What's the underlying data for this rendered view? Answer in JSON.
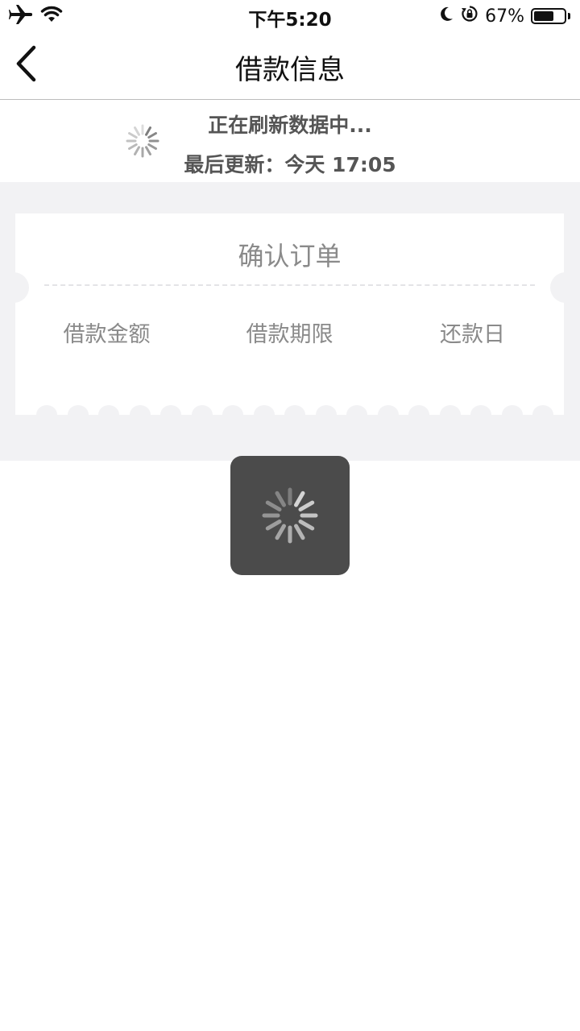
{
  "status_bar": {
    "time": "下午5:20",
    "battery_text": "67%",
    "battery_level": 0.67,
    "icons": [
      "airplane-icon",
      "wifi-icon",
      "moon-icon",
      "rotation-lock-icon",
      "battery-icon"
    ]
  },
  "nav": {
    "title": "借款信息",
    "back_icon": "chevron-left-icon"
  },
  "refresh": {
    "status": "正在刷新数据中...",
    "last_updated": "最后更新：今天 17:05"
  },
  "order": {
    "title": "确认订单",
    "labels": [
      "借款金额",
      "借款期限",
      "还款日"
    ]
  },
  "colors": {
    "band": "#f2f2f4",
    "hud": "#4b4b4b",
    "label": "#8a8a8a"
  }
}
